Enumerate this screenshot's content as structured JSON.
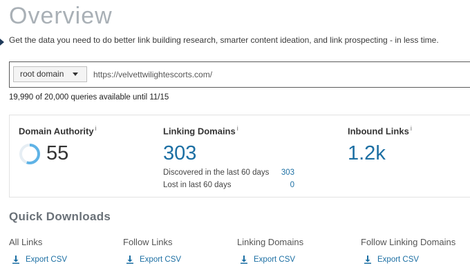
{
  "header": {
    "title": "Overview",
    "subtitle": "Get the data you need to do better link building research, smarter content ideation, and link prospecting - in less time."
  },
  "search": {
    "scope_selected": "root domain",
    "url_value": "https://velvettwilightescorts.com/"
  },
  "quota_text": "19,990 of 20,000 queries available until 11/15",
  "metrics": {
    "domain_authority": {
      "label": "Domain Authority",
      "info": "i",
      "value": "55"
    },
    "linking_domains": {
      "label": "Linking Domains",
      "info": "i",
      "value": "303",
      "discovered_label": "Discovered in the last 60 days",
      "discovered_value": "303",
      "lost_label": "Lost in last 60 days",
      "lost_value": "0"
    },
    "inbound_links": {
      "label": "Inbound Links",
      "info": "i",
      "value": "1.2k"
    }
  },
  "quick_downloads": {
    "title": "Quick Downloads",
    "items": [
      {
        "heading": "All Links",
        "action": "Export CSV"
      },
      {
        "heading": "Follow Links",
        "action": "Export CSV"
      },
      {
        "heading": "Linking Domains",
        "action": "Export CSV"
      },
      {
        "heading": "Follow Linking Domains",
        "action": "Export CSV"
      }
    ]
  },
  "colors": {
    "accent_blue": "#1c6fa3",
    "ring_blue": "#5fb3e6",
    "title_gray": "#a9b0b6"
  },
  "icons": {
    "download": "download-icon",
    "caret": "chevron-down-icon",
    "info": "info-icon"
  }
}
